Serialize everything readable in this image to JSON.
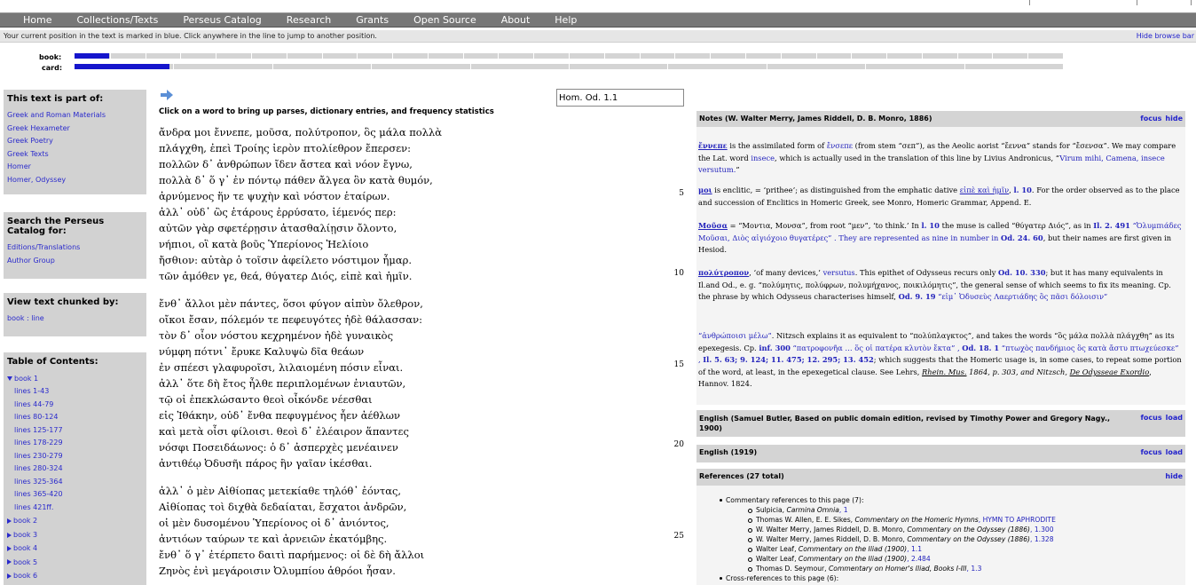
{
  "nav": {
    "items": [
      "Home",
      "Collections/Texts",
      "Perseus Catalog",
      "Research",
      "Grants",
      "Open Source",
      "About",
      "Help"
    ]
  },
  "position_bar": {
    "message": "Your current position in the text is marked in blue. Click anywhere in the line to jump to another position.",
    "hide_label": "Hide browse bar"
  },
  "browse": {
    "book_label": "book:",
    "card_label": "card:",
    "book_progress": 0.035,
    "card_progress": 0.096
  },
  "sidebar": {
    "part_of": {
      "title": "This text is part of:",
      "links": [
        "Greek and Roman Materials",
        "Greek Hexameter",
        "Greek Poetry",
        "Greek Texts",
        "Homer",
        "Homer, Odyssey"
      ]
    },
    "search": {
      "title": "Search the Perseus Catalog for:",
      "links": [
        "Editions/Translations",
        "Author Group"
      ]
    },
    "chunk": {
      "title": "View text chunked by:",
      "link": "book : line"
    },
    "toc": {
      "title": "Table of Contents:",
      "book1": "book 1",
      "book1_lines": [
        "lines 1-43",
        "lines 44-79",
        "lines 80-124",
        "lines 125-177",
        "lines 178-229",
        "lines 230-279",
        "lines 280-324",
        "lines 325-364",
        "lines 365-420",
        "lines 421ff."
      ],
      "books": [
        "book 2",
        "book 3",
        "book 4",
        "book 5",
        "book 6"
      ]
    }
  },
  "text": {
    "instruction": "Click on a word to bring up parses, dictionary entries, and frequency statistics",
    "location_value": "Hom. Od. 1.1",
    "stanzas": [
      [
        "ἄνδρα μοι ἔννεπε, μοῦσα, πολύτροπον, ὃς μάλα πολλὰ",
        "πλάγχθη, ἐπεὶ Τροίης ἱερὸν πτολίεθρον ἔπερσεν:",
        "πολλῶν δ᾽ ἀνθρώπων ἴδεν ἄστεα καὶ νόον ἔγνω,",
        "πολλὰ δ᾽ ὅ γ᾽ ἐν πόντῳ πάθεν ἄλγεα ὃν κατὰ θυμόν,",
        "ἀρνύμενος ἥν τε ψυχὴν καὶ νόστον ἑταίρων.",
        "ἀλλ᾽ οὐδ᾽ ὣς ἑτάρους ἐρρύσατο, ἱέμενός περ:",
        "αὐτῶν γὰρ σφετέρῃσιν ἀτασθαλίῃσιν ὄλοντο,",
        "νήπιοι, οἳ κατὰ βοῦς Ὑπερίονος Ἠελίοιο",
        "ἤσθιον: αὐτὰρ ὁ τοῖσιν ἀφείλετο νόστιμον ἦμαρ.",
        "τῶν ἁμόθεν γε, θεά, θύγατερ Διός, εἰπὲ καὶ ἡμῖν."
      ],
      [
        "ἔνθ᾽ ἄλλοι μὲν πάντες, ὅσοι φύγον αἰπὺν ὄλεθρον,",
        "οἴκοι ἔσαν, πόλεμόν τε πεφευγότες ἠδὲ θάλασσαν:",
        "τὸν δ᾽ οἶον νόστου κεχρημένον ἠδὲ γυναικὸς",
        "νύμφη πότνι᾽ ἔρυκε Καλυψὼ δῖα θεάων",
        "ἐν σπέεσι γλαφυροῖσι, λιλαιομένη πόσιν εἶναι.",
        "ἀλλ᾽ ὅτε δὴ ἔτος ἦλθε περιπλομένων ἐνιαυτῶν,",
        "τῷ οἱ ἐπεκλώσαντο θεοὶ οἶκόνδε νέεσθαι",
        "εἰς Ἰθάκην, οὐδ᾽ ἔνθα πεφυγμένος ἦεν ἀέθλων",
        "καὶ μετὰ οἷσι φίλοισι. θεοὶ δ᾽ ἐλέαιρον ἅπαντες",
        "νόσφι Ποσειδάωνος: ὁ δ᾽ ἀσπερχὲς μενέαινεν",
        "ἀντιθέῳ Ὀδυσῆι πάρος ἣν γαῖαν ἱκέσθαι."
      ],
      [
        "ἀλλ᾽ ὁ μὲν Αἰθίοπας μετεκίαθε τηλόθ᾽ ἐόντας,",
        "Αἰθίοπας τοὶ διχθὰ δεδαίαται, ἔσχατοι ἀνδρῶν,",
        "οἱ μὲν δυσομένου Ὑπερίονος οἱ δ᾽ ἀνιόντος,",
        "ἀντιόων ταύρων τε καὶ ἀρνειῶν ἑκατόμβης.",
        "ἔνθ᾽ ὅ γ᾽ ἐτέρπετο δαιτὶ παρήμενος: οἱ δὲ δὴ ἄλλοι",
        "Ζηνὸς ἐνὶ μεγάροισιν Ὀλυμπίου ἁθρόοι ἦσαν."
      ]
    ],
    "line_numbers": [
      "5",
      "10",
      "15",
      "20",
      "25"
    ]
  },
  "notes": {
    "header": "Notes (W. Walter Merry, James Riddell, D. B. Monro, 1886)",
    "focus": "focus",
    "hide": "hide",
    "n1": {
      "lemma": "ἔννεπε",
      "t1": " is the assimilated form of ",
      "l1": "ἔνσεπε",
      "t2": " (from stem “σεπ”), as the Aeolic aorist “ἔεννα” stands for “ἔσενσα”. We may compare the Lat. word ",
      "l2": "insece",
      "t3": ", which is actually used in the translation of this line by Livius Andronicus, “",
      "l3": "Virum mihi, Camena, insece versutum.",
      "t4": "”"
    },
    "n2": {
      "lemma": "μοι",
      "t1": " is enclitic, = ‘prithee’; as distinguished from the emphatic dative ",
      "l1": "εἰπὲ καὶ ἡμῖν",
      "t2": ", ",
      "l2": "l. 10",
      "t3": ". For the order observed as to the place and succession of Enclitics in Homeric Greek, see Monro, Homeric Grammar, Append. E."
    },
    "n3": {
      "lemma": "Μοῦσα",
      "t1": " = “Μοντια, Μονσα”, from root “μεν”, ‘to think.’ In ",
      "l1": "l. 10",
      "t2": " the muse is called “θύγατερ Διός”, as in ",
      "l2": "Il. 2. 491",
      "t3": " “Ὀλυμπιάδες Μοῦσαι, Διὸς αἰγιόχοιο θυγατέρες” . They are represented as nine in number in ",
      "l3": "Od. 24. 60",
      "t4": ", but their names are first given in Hesiod."
    },
    "n4": {
      "lemma": "πολύτροπον",
      "t1": ", ‘of many devices,’ ",
      "l1": "versutus",
      "t2": ". This epithet of Odysseus recurs only ",
      "l2": "Od. 10. 330",
      "t3": "; but it has many equivalents in Il.and Od., e. g. “πολύμητις, πολύφρων, πολυμήχανος, ποικιλόμητις”, the general sense of which seems to fix its meaning. Cp. the phrase by which Odysseus characterises himself, ",
      "l3": "Od. 9. 19",
      "t4": " “εἰμ᾽ Ὀδυσεὺς Λαερτιάδης ὃς πᾶσι δόλοισιν”"
    },
    "n5": {
      "l0": "“ἀνθρώποισι μέλω”",
      "t1": ". Nitzsch explains it as equivalent to “πολύπλαγκτος”, and takes the words “ὃς μάλα πολλὰ πλάγχθη” as its epexegesis. Cp. ",
      "l1": "inf. 300",
      "t2": " “πατροφονῆα … ὅς οἱ πατέρα κλυτὸν ἔκτα” , ",
      "l2": "Od. 18. 1",
      "t3": " “πτωχὸς πανδήμιος ὃς κατὰ ἄστυ πτωχεύεσκε” , ",
      "l3": "Il. 5. 63; 9. 124; 11. 475; 12. 295; 13. 452",
      "t4": "; which suggests that the Homeric usage is, in some cases, to repeat some portion of the word, at least, in the epexegetical clause. See Lehrs, ",
      "l4": "Rhein. Mus.",
      "t5": " 1864, p. 303, and Nitzsch, ",
      "l5": "De Odysseae Exordio",
      "t6": ", Hannov. 1824."
    }
  },
  "english1": {
    "header": "English (Samuel Butler, Based on public domain edition, revised by Timothy Power and Gregory Nagy., 1900)",
    "focus": "focus",
    "load": "load"
  },
  "english2": {
    "header": "English (1919)",
    "focus": "focus",
    "load": "load"
  },
  "references": {
    "header": "References (27 total)",
    "hide": "hide",
    "commentary_title": "Commentary references to this page (7):",
    "items": [
      {
        "plain": "Sulpicia, ",
        "ital": "Carmina Omnia",
        "link": ", 1"
      },
      {
        "plain": "Thomas W. Allen, E. E. Sikes, ",
        "ital": "Commentary on the Homeric Hymns",
        "link": ", HYMN TO APHRODITE"
      },
      {
        "plain": "W. Walter Merry, James Riddell, D. B. Monro, ",
        "ital": "Commentary on the Odyssey (1886)",
        "link": ", 1.300"
      },
      {
        "plain": "W. Walter Merry, James Riddell, D. B. Monro, ",
        "ital": "Commentary on the Odyssey (1886)",
        "link": ", 1.328"
      },
      {
        "plain": "Walter Leaf, ",
        "ital": "Commentary on the Iliad (1900)",
        "link": ", 1.1"
      },
      {
        "plain": "Walter Leaf, ",
        "ital": "Commentary on the Iliad (1900)",
        "link": ", 2.484"
      },
      {
        "plain": "Thomas D. Seymour, ",
        "ital": "Commentary on Homer's Iliad, Books I-III",
        "link": ", 1.3"
      }
    ],
    "cross_title": "Cross-references to this page (6):"
  },
  "colors": {
    "link": "#2a2acc",
    "progress": "#1515cc",
    "navbar": "#777777",
    "panel": "#d4d4d4"
  }
}
